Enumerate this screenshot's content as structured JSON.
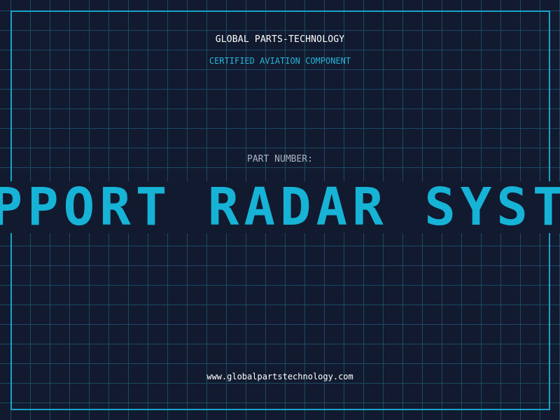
{
  "header": {
    "company": "GLOBAL PARTS-TECHNOLOGY",
    "subtitle": "CERTIFIED AVIATION COMPONENT"
  },
  "main": {
    "label": "PART NUMBER:",
    "part_number": "SUPPORT RADAR SYSTEM"
  },
  "footer": {
    "website": "www.globalpartstechnology.com"
  },
  "colors": {
    "background": "#111a2e",
    "grid": "#1d4a63",
    "accent": "#16b3d6",
    "text": "#ffffff",
    "muted": "#a8b4c4"
  }
}
